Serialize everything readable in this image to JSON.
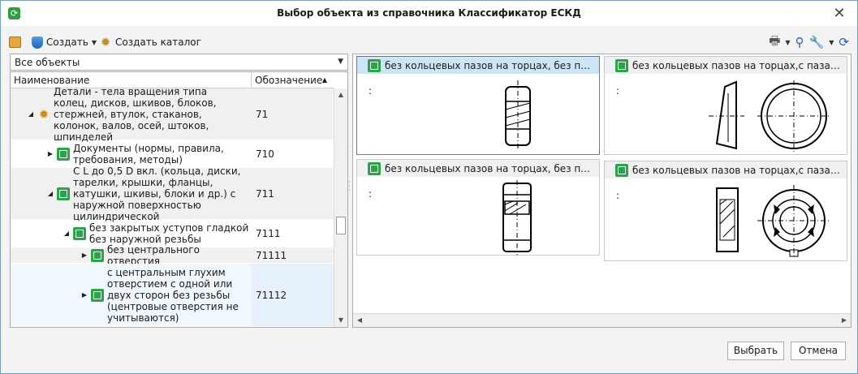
{
  "window": {
    "title": "Выбор объекта из справочника Классификатор ЕСКД"
  },
  "toolbar": {
    "create_label": "Создать",
    "create_catalog_label": "Создать каталог"
  },
  "filter": {
    "selected": "Все объекты"
  },
  "tree": {
    "columns": {
      "name": "Наименование",
      "code": "Обозначение"
    },
    "rows": [
      {
        "name": "Детали - тела вращения типа колец, дисков, шкивов, блоков, стержней, втулок, стаканов, колонок, валов, осей, штоков, шпинделей",
        "code": "71"
      },
      {
        "name": "Документы (нормы, правила, требования, методы)",
        "code": "710"
      },
      {
        "name": "С L до 0,5 D вкл. (кольца, диски, тарелки, крышки, фланцы, катушки, шкивы, блоки и др.) с наружной поверхностью цилиндрической",
        "code": "711"
      },
      {
        "name": "без закрытых уступов гладкой без наружной резьбы",
        "code": "7111"
      },
      {
        "name": "без центрального отверстия",
        "code": "71111"
      },
      {
        "name": "с центральным глухим отверстием с одной или двух сторон без резьбы (центровые отверстия не учитываются)",
        "code": "71112"
      }
    ]
  },
  "gallery": {
    "cards": [
      {
        "title": "без кольцевых пазов на торцах, без пазов...",
        "note": ":"
      },
      {
        "title": "без кольцевых пазов на торцах,с пазами...",
        "note": ":"
      },
      {
        "title": "без кольцевых пазов на торцах, без пазов...",
        "note": ":"
      },
      {
        "title": "без кольцевых пазов на торцах,с пазами...",
        "note": ":"
      }
    ]
  },
  "buttons": {
    "ok": "Выбрать",
    "cancel": "Отмена"
  }
}
